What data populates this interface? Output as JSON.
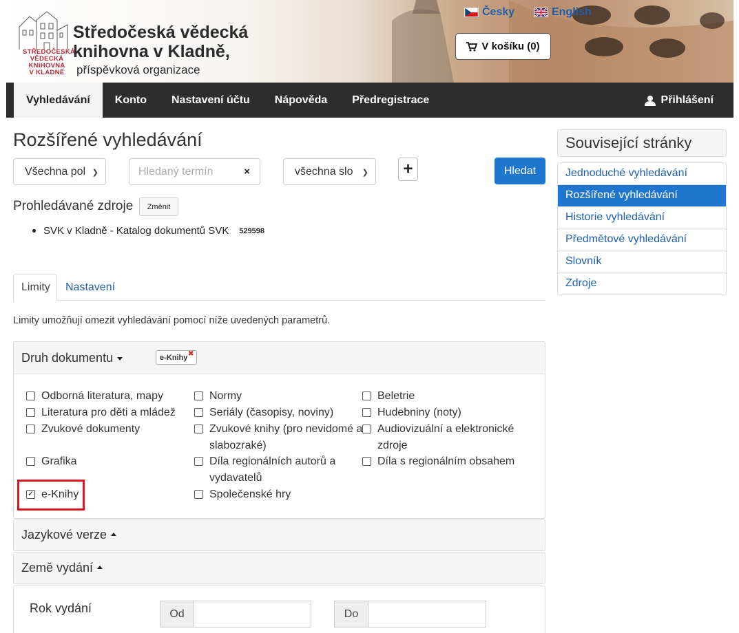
{
  "header": {
    "logo_text": [
      "STŘEDOČESKÁ",
      "VĚDECKÁ",
      "KNIHOVNA",
      "V KLADNĚ"
    ],
    "title_line1": "Středočeská vědecká",
    "title_line2": "knihovna v Kladně,",
    "subtitle": "příspěvková organizace",
    "lang_czech": "Česky",
    "lang_english": "English",
    "cart_label": "V košíku (0)"
  },
  "nav": {
    "items": [
      "Vyhledávání",
      "Konto",
      "Nastavení účtu",
      "Nápověda",
      "Předregistrace"
    ],
    "login": "Přihlášení"
  },
  "main": {
    "title": "Rozšířené vyhledávání",
    "field_select": "Všechna pol",
    "search_placeholder": "Hledaný termín",
    "match_select": "všechna slo",
    "search_button": "Hledat",
    "sources_label": "Prohledávané zdroje",
    "change_button": "Změnit",
    "source_name": "SVK v Kladně - Katalog dokumentů SVK",
    "source_count": "529598",
    "tabs": [
      "Limity",
      "Nastavení"
    ],
    "limits_description": "Limity umožňují omezit vyhledávání pomocí níže uvedených parametrů."
  },
  "doc_type": {
    "title": "Druh dokumentu",
    "active_filter": "e-Knihy",
    "options": [
      {
        "label": "Odborná literatura, mapy",
        "checked": false
      },
      {
        "label": "Normy",
        "checked": false
      },
      {
        "label": "Beletrie",
        "checked": false
      },
      {
        "label": "Literatura pro děti a mládež",
        "checked": false
      },
      {
        "label": "Seriály (časopisy, noviny)",
        "checked": false
      },
      {
        "label": "Hudebniny (noty)",
        "checked": false
      },
      {
        "label": "Zvukové dokumenty",
        "checked": false
      },
      {
        "label": "Zvukové knihy (pro nevidomé a slabozraké)",
        "checked": false
      },
      {
        "label": "Audiovizuální a elektronické zdroje",
        "checked": false
      },
      {
        "label": "Grafika",
        "checked": false
      },
      {
        "label": "Díla regionálních autorů a vydavatelů",
        "checked": false
      },
      {
        "label": "Díla s regionálním obsahem",
        "checked": false
      },
      {
        "label": "e-Knihy",
        "checked": true
      },
      {
        "label": "Společenské hry",
        "checked": false
      }
    ]
  },
  "panels": {
    "languages": "Jazykové verze",
    "country": "Země vydání"
  },
  "year": {
    "label": "Rok vydání",
    "from": "Od",
    "to": "Do"
  },
  "sidebar": {
    "title": "Související stránky",
    "items": [
      "Jednoduché vyhledávání",
      "Rozšířené vyhledávání",
      "Historie vyhledávání",
      "Předmětové vyhledávání",
      "Slovník",
      "Zdroje"
    ]
  },
  "colors": {
    "accent": "#1f76cf",
    "nav_bg": "#2d2d2d",
    "link": "#1f5ea8",
    "highlight": "#e0141f"
  }
}
